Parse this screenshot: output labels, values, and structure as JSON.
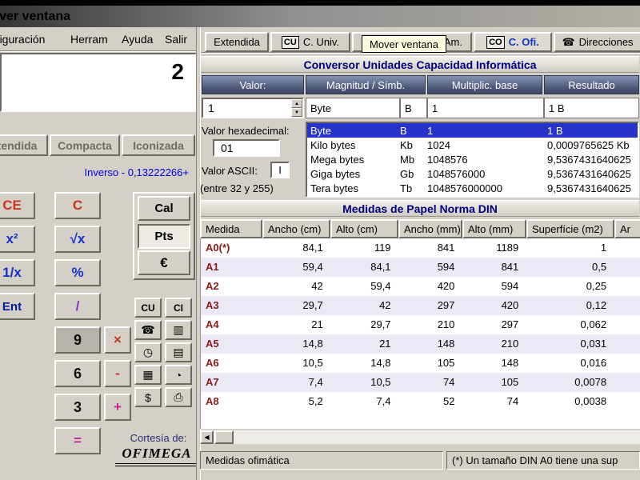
{
  "window": {
    "title": "Mover ventana"
  },
  "icons": {
    "spinner_up": "▲",
    "spinner_down": "▼",
    "scroll_left": "◀",
    "phone": "☎"
  },
  "palette": {
    "accent_navy": "#000080",
    "selection_blue": "#2634cc",
    "medida_red": "#8b1a1a",
    "active_tab_blue": "#1133cc",
    "tooltip_yellow": "#ffffe1",
    "window_gray": "#d4d0c8"
  },
  "left": {
    "menu": [
      "Configuración",
      "Herram",
      "Ayuda",
      "Salir"
    ],
    "display_value": "2",
    "view_tabs": [
      "Extendida",
      "Compacta",
      "Iconizada"
    ],
    "inverse_label": "Inverso - 0,13222266+",
    "calc": {
      "colA": [
        "CE",
        "x²",
        "1/x",
        "Ent"
      ],
      "colB": [
        "C",
        "√x",
        "%",
        "/",
        "9",
        "6",
        "3",
        "="
      ],
      "colC": [
        "×",
        "-",
        "+"
      ],
      "side": [
        "Cal",
        "Pts",
        "€"
      ],
      "mini": [
        "CU",
        "CI",
        "☎",
        "▥",
        "◷",
        "▤",
        "▦",
        "◔",
        "$",
        "⎙"
      ]
    },
    "courtesy": "Cortesía de:",
    "logo": "OFIMEGA"
  },
  "right": {
    "tabs": [
      {
        "label": "Extendida"
      },
      {
        "badge": "CU",
        "label": "C. Univ."
      },
      {
        "label": "C. Am."
      },
      {
        "badge": "CO",
        "label": "C. Ofi."
      },
      {
        "label": "Direcciones"
      }
    ],
    "tooltip": "Mover ventana",
    "converter": {
      "title": "Conversor Unidades Capacidad Informática",
      "col_headers": [
        "Valor:",
        "Magnitud / Símb.",
        "Multiplic. base",
        "Resultado"
      ],
      "value_input": "1",
      "selected_magnitude": "Byte",
      "selected_symbol": "B",
      "selected_base": "1",
      "selected_result": "1 B",
      "hex_label": "Valor hexadecimal:",
      "hex_value": "01",
      "ascii_label": "Valor ASCII:",
      "ascii_value": "I",
      "ascii_hint": "(entre 32 y 255)",
      "rows": [
        {
          "name": "Byte",
          "sym": "B",
          "base": "1",
          "result": "1 B"
        },
        {
          "name": "Kilo bytes",
          "sym": "Kb",
          "base": "1024",
          "result": "0,0009765625 Kb"
        },
        {
          "name": "Mega bytes",
          "sym": "Mb",
          "base": "1048576",
          "result": "9,5367431640625"
        },
        {
          "name": "Giga bytes",
          "sym": "Gb",
          "base": "1048576000",
          "result": "9,5367431640625"
        },
        {
          "name": "Tera bytes",
          "sym": "Tb",
          "base": "1048576000000",
          "result": "9,5367431640625"
        }
      ]
    },
    "paper": {
      "title": "Medidas de Papel Norma DIN",
      "col_headers": [
        "Medida",
        "Ancho (cm)",
        "Alto (cm)",
        "Ancho (mm)",
        "Alto (mm)",
        "Superfície (m2)",
        "Ar"
      ],
      "rows": [
        {
          "medida": "A0(*)",
          "vals": [
            "84,1",
            "119",
            "841",
            "1189",
            "1"
          ]
        },
        {
          "medida": "A1",
          "vals": [
            "59,4",
            "84,1",
            "594",
            "841",
            "0,5"
          ]
        },
        {
          "medida": "A2",
          "vals": [
            "42",
            "59,4",
            "420",
            "594",
            "0,25"
          ]
        },
        {
          "medida": "A3",
          "vals": [
            "29,7",
            "42",
            "297",
            "420",
            "0,12"
          ]
        },
        {
          "medida": "A4",
          "vals": [
            "21",
            "29,7",
            "210",
            "297",
            "0,062"
          ]
        },
        {
          "medida": "A5",
          "vals": [
            "14,8",
            "21",
            "148",
            "210",
            "0,031"
          ]
        },
        {
          "medida": "A6",
          "vals": [
            "10,5",
            "14,8",
            "105",
            "148",
            "0,016"
          ]
        },
        {
          "medida": "A7",
          "vals": [
            "7,4",
            "10,5",
            "74",
            "105",
            "0,0078"
          ]
        },
        {
          "medida": "A8",
          "vals": [
            "5,2",
            "7,4",
            "52",
            "74",
            "0,0038"
          ]
        }
      ]
    },
    "status": [
      "Medidas ofimática",
      "(*) Un tamaño DIN A0 tiene una sup"
    ]
  }
}
